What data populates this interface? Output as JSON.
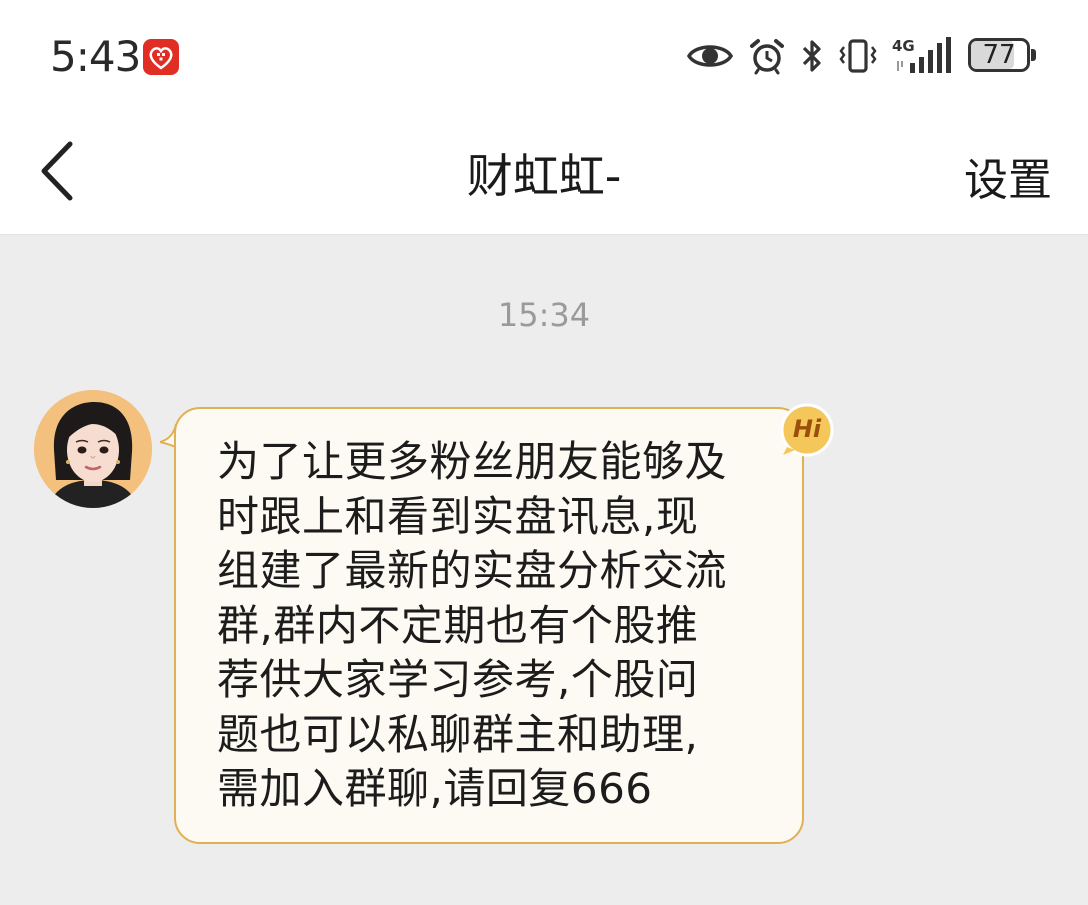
{
  "status_bar": {
    "time": "5:43",
    "app_badge_icon": "pinduoduo-app-icon",
    "icons": [
      "eye-icon",
      "alarm-icon",
      "bluetooth-icon",
      "vibrate-icon",
      "signal-4g-icon"
    ],
    "network_label": "4G",
    "battery_level": "77",
    "battery_fraction": 0.77
  },
  "nav": {
    "back_icon": "chevron-left-icon",
    "title": "财虹虹-",
    "settings_label": "设置"
  },
  "chat": {
    "timestamp": "15:34",
    "messages": [
      {
        "sender_avatar": "avatar-icon",
        "text": "为了让更多粉丝朋友能够及\n时跟上和看到实盘讯息,现\n组建了最新的实盘分析交流\n群,群内不定期也有个股推\n荐供大家学习参考,个股问\n题也可以私聊群主和助理,\n需加入群聊,请回复666",
        "badge_label": "Hi"
      }
    ]
  },
  "colors": {
    "background": "#ededed",
    "bubble_fill": "#fdfaf3",
    "bubble_border": "#e0b054",
    "badge_red": "#e02e24",
    "hi_badge": "#f5c65a"
  }
}
